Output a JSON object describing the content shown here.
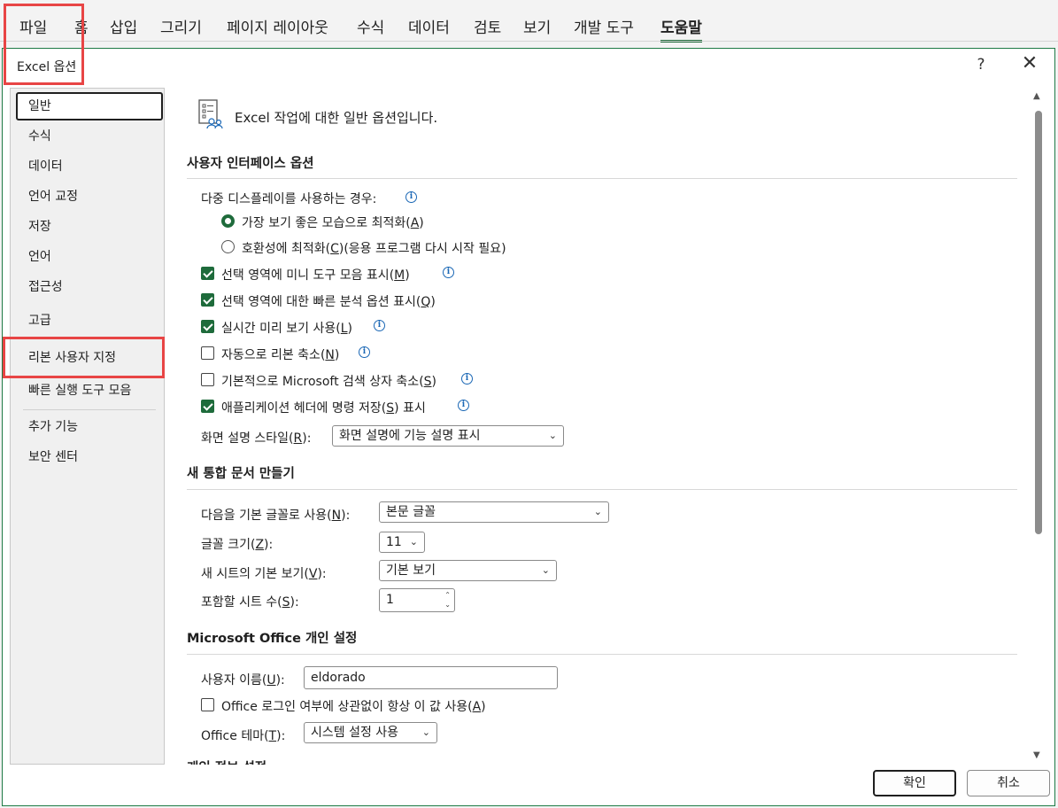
{
  "ribbon": {
    "tabs": [
      "파일",
      "홈",
      "삽입",
      "그리기",
      "페이지 레이아웃",
      "수식",
      "데이터",
      "검토",
      "보기",
      "개발 도구",
      "도움말"
    ],
    "active_tab": "도움말"
  },
  "dialog": {
    "title": "Excel 옵션",
    "help": "?",
    "close": "✕",
    "ok_label": "확인",
    "cancel_label": "취소"
  },
  "nav": {
    "items": [
      "일반",
      "수식",
      "데이터",
      "언어 교정",
      "저장",
      "언어",
      "접근성",
      "고급",
      "리본 사용자 지정",
      "빠른 실행 도구 모음",
      "추가 기능",
      "보안 센터"
    ],
    "selected": "일반"
  },
  "content": {
    "header": "Excel 작업에 대한 일반 옵션입니다.",
    "ui_section": {
      "title": "사용자 인터페이스 옵션",
      "multi_display_label": "다중 디스플레이를 사용하는 경우:",
      "radio_best": {
        "pre": "가장 보기 좋은 모습으로 최적화(",
        "key": "A",
        "post": ")",
        "checked": true
      },
      "radio_compat": {
        "pre": "호환성에 최적화(",
        "key": "C",
        "post": ")(응용 프로그램 다시 시작 필요)",
        "checked": false
      },
      "checks": [
        {
          "pre": "선택 영역에 미니 도구 모음 표시(",
          "key": "M",
          "post": ")",
          "checked": true,
          "info": true
        },
        {
          "pre": "선택 영역에 대한 빠른 분석 옵션 표시(",
          "key": "Q",
          "post": ")",
          "checked": true,
          "info": false
        },
        {
          "pre": "실시간 미리 보기 사용(",
          "key": "L",
          "post": ")",
          "checked": true,
          "info": true
        },
        {
          "pre": "자동으로 리본 축소(",
          "key": "N",
          "post": ")",
          "checked": false,
          "info": true
        },
        {
          "pre": "기본적으로 Microsoft 검색 상자 축소(",
          "key": "S",
          "post": ")",
          "checked": false,
          "info": true
        },
        {
          "pre": "애플리케이션 헤더에 명령 저장(",
          "key": "S",
          "post": ") 표시",
          "checked": true,
          "info": true
        }
      ],
      "tooltip_style": {
        "pre": "화면 설명 스타일(",
        "key": "R",
        "post": "):",
        "value": "화면 설명에 기능 설명 표시"
      }
    },
    "new_wb_section": {
      "title": "새 통합 문서 만들기",
      "font": {
        "pre": "다음을 기본 글꼴로 사용(",
        "key": "N",
        "post": "):",
        "value": "본문 글꼴"
      },
      "font_size": {
        "pre": "글꼴 크기(",
        "key": "Z",
        "post": "):",
        "value": "11"
      },
      "default_view": {
        "pre": "새 시트의 기본 보기(",
        "key": "V",
        "post": "):",
        "value": "기본 보기"
      },
      "sheet_count": {
        "pre": "포함할 시트 수(",
        "key": "S",
        "post": "):",
        "value": "1"
      }
    },
    "office_section": {
      "title": "Microsoft Office 개인 설정",
      "username": {
        "pre": "사용자 이름(",
        "key": "U",
        "post": "):",
        "value": "eldorado"
      },
      "always_use": {
        "pre": "Office 로그인 여부에 상관없이 항상 이 값 사용(",
        "key": "A",
        "post": ")",
        "checked": false
      },
      "theme": {
        "pre": "Office 테마(",
        "key": "T",
        "post": "):",
        "value": "시스템 설정 사용"
      }
    },
    "next_section_title": "개인 정보 설정"
  },
  "icons": {
    "caret": "⌄",
    "info": "i",
    "spin_up": "⌃",
    "spin_down": "⌄",
    "scroll_up": "▲",
    "scroll_down": "▼"
  },
  "colors": {
    "accent": "#1e6b3b",
    "callout": "#e84545",
    "info": "#1a67b5"
  }
}
